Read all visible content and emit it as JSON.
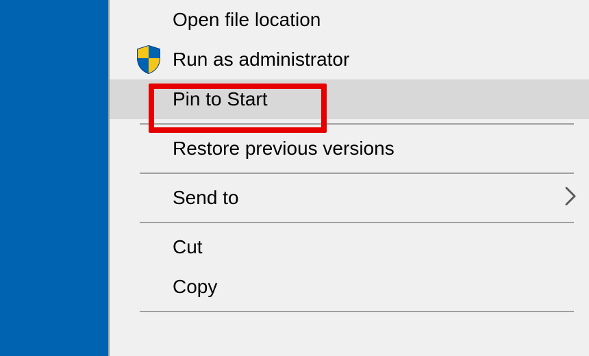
{
  "contextMenu": {
    "items": {
      "openFileLocation": {
        "label": "Open file location"
      },
      "runAsAdministrator": {
        "label": "Run as administrator",
        "icon": "shield-icon"
      },
      "pinToStart": {
        "label": "Pin to Start",
        "highlighted": true
      },
      "restorePreviousVersions": {
        "label": "Restore previous versions"
      },
      "sendTo": {
        "label": "Send to",
        "hasSubmenu": true
      },
      "cut": {
        "label": "Cut"
      },
      "copy": {
        "label": "Copy"
      }
    }
  }
}
